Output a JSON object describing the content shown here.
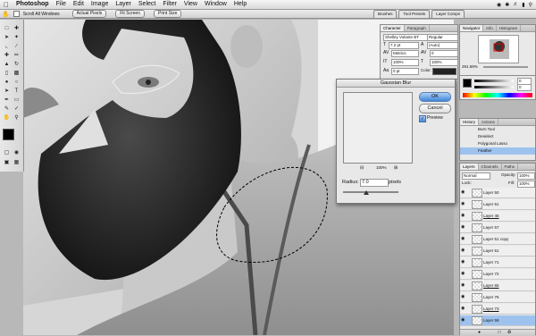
{
  "menubar": {
    "apple": "",
    "app_name": "Photoshop",
    "items": [
      "File",
      "Edit",
      "Image",
      "Layer",
      "Select",
      "Filter",
      "View",
      "Window",
      "Help"
    ]
  },
  "options": {
    "scroll_all_windows": "Scroll All Windows",
    "actual_pixels": "Actual Pixels",
    "fit_screen": "Fit Screen",
    "print_size": "Print Size",
    "wells": [
      "Brushes",
      "Tool Presets",
      "Layer Comps"
    ]
  },
  "character": {
    "tabs": [
      "Character",
      "Paragraph"
    ],
    "font": "Shelley Volante BT",
    "style": "Regular",
    "size": "7.2 pt",
    "leading": "(Auto)",
    "kerning": "Metrics",
    "tracking": "0",
    "vscale": "100%",
    "hscale": "100%",
    "baseline": "0 pt",
    "color_label": "Color:"
  },
  "navigator": {
    "tabs": [
      "Navigator",
      "Info",
      "Histogram"
    ],
    "zoom": "291.59%"
  },
  "color_panel": {
    "values": [
      "0",
      "0",
      "82"
    ]
  },
  "history": {
    "tabs": [
      "History",
      "Actions"
    ],
    "items": [
      "Burn Tool",
      "Deselect",
      "Polygonal Lasso",
      "Feather"
    ]
  },
  "layers": {
    "tabs": [
      "Layers",
      "Channels",
      "Paths"
    ],
    "blend": "Normal",
    "opacity_label": "Opacity:",
    "opacity": "100%",
    "lock_label": "Lock:",
    "fill_label": "Fill:",
    "fill": "100%",
    "rows": [
      {
        "name": "Layer 50",
        "sel": false,
        "ul": false
      },
      {
        "name": "Layer 51",
        "sel": false,
        "ul": false
      },
      {
        "name": "Layer 45",
        "sel": false,
        "ul": true
      },
      {
        "name": "Layer 57",
        "sel": false,
        "ul": false
      },
      {
        "name": "Layer 51 copy",
        "sel": false,
        "ul": false
      },
      {
        "name": "Layer 61",
        "sel": false,
        "ul": false
      },
      {
        "name": "Layer 71",
        "sel": false,
        "ul": false
      },
      {
        "name": "Layer 72",
        "sel": false,
        "ul": false
      },
      {
        "name": "Layer 65",
        "sel": false,
        "ul": true
      },
      {
        "name": "Layer 76",
        "sel": false,
        "ul": false
      },
      {
        "name": "Layer 73",
        "sel": false,
        "ul": true
      },
      {
        "name": "Layer 59",
        "sel": true,
        "ul": false
      }
    ]
  },
  "gaussian": {
    "title": "Gaussian Blur",
    "ok": "OK",
    "cancel": "Cancel",
    "preview_label": "Preview",
    "preview_checked": true,
    "zoom": "100%",
    "radius_label": "Radius:",
    "radius": "7.0",
    "units": "pixels"
  }
}
